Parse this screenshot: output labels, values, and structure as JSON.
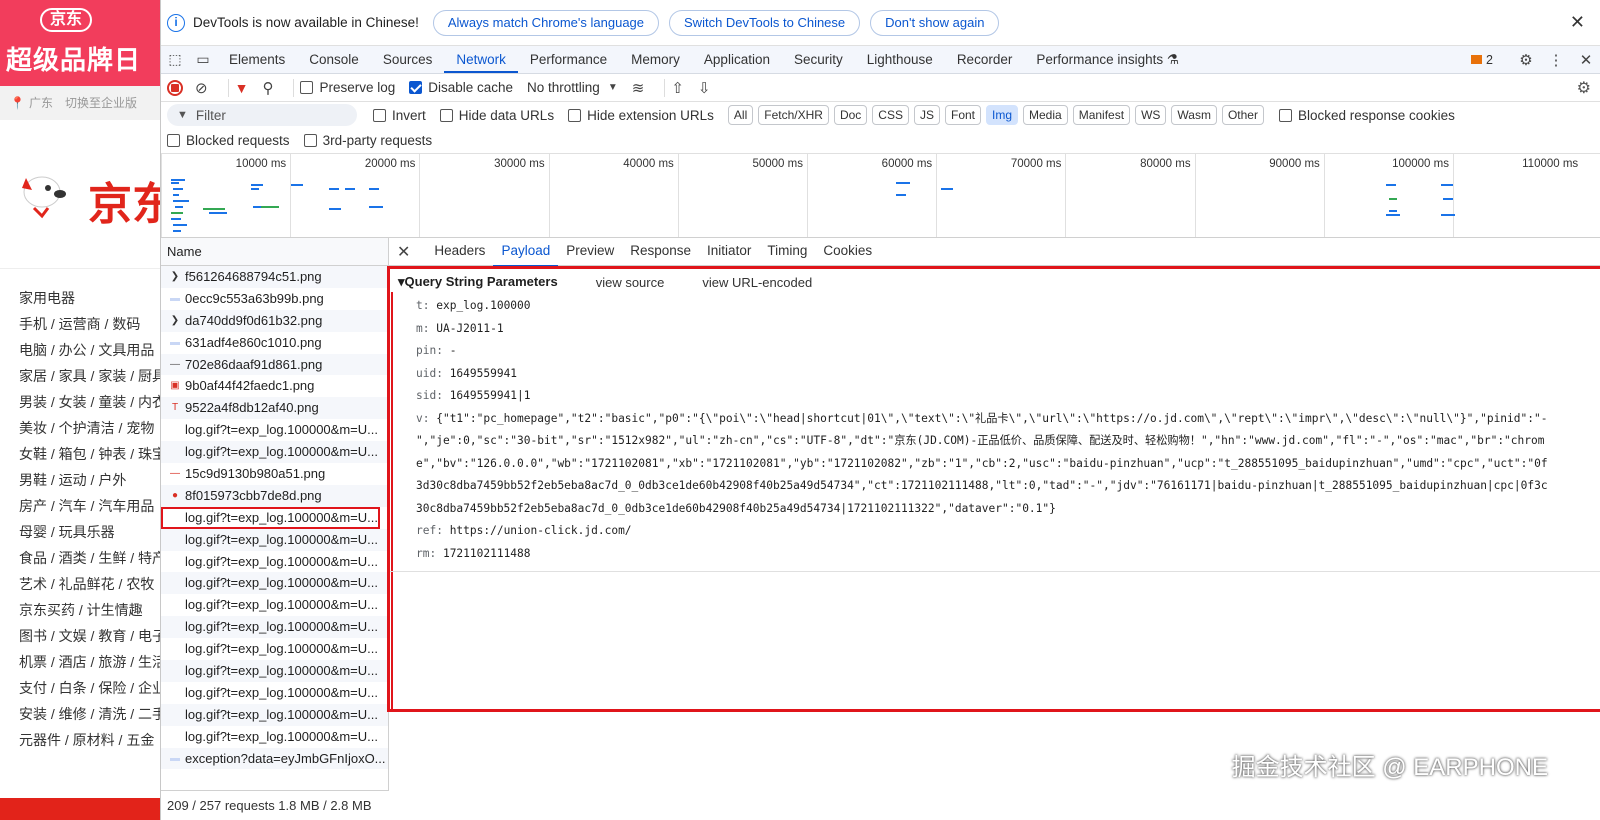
{
  "jd": {
    "banner_top": "京东",
    "banner_main": "超级品牌日",
    "location": "广东",
    "enterprise": "切换至企业版",
    "logo_text": "京东",
    "categories": [
      "家用电器",
      "手机 / 运营商 / 数码",
      "电脑 / 办公 / 文具用品",
      "家居 / 家具 / 家装 / 厨具",
      "男装 / 女装 / 童装 / 内衣",
      "美妆 / 个护清洁 / 宠物",
      "女鞋 / 箱包 / 钟表 / 珠宝",
      "男鞋 / 运动 / 户外",
      "房产 / 汽车 / 汽车用品",
      "母婴 / 玩具乐器",
      "食品 / 酒类 / 生鲜 / 特产",
      "艺术 / 礼品鲜花 / 农牧",
      "京东买药 / 计生情趣",
      "图书 / 文娱 / 教育 / 电子书",
      "机票 / 酒店 / 旅游 / 生活",
      "支付 / 白条 / 保险 / 企业",
      "安装 / 维修 / 清洗 / 二手",
      "元器件 / 原材料 / 五金"
    ]
  },
  "infobar": {
    "icon": "info-icon",
    "text": "DevTools is now available in Chinese!",
    "btn1": "Always match Chrome's language",
    "btn2": "Switch DevTools to Chinese",
    "btn3": "Don't show again",
    "close": "✕"
  },
  "tabs": [
    "Elements",
    "Console",
    "Sources",
    "Network",
    "Performance",
    "Memory",
    "Application",
    "Security",
    "Lighthouse",
    "Recorder",
    "Performance insights ⚗"
  ],
  "active_tab": "Network",
  "issues_count": "2",
  "toolbar": {
    "preserve_log": "Preserve log",
    "disable_cache": "Disable cache",
    "throttling": "No throttling"
  },
  "filter": {
    "placeholder": "Filter",
    "invert": "Invert",
    "hide_data": "Hide data URLs",
    "hide_ext": "Hide extension URLs",
    "chips": [
      "All",
      "Fetch/XHR",
      "Doc",
      "CSS",
      "JS",
      "Font",
      "Img",
      "Media",
      "Manifest",
      "WS",
      "Wasm",
      "Other"
    ],
    "active_chip": "Img",
    "blocked_cookies": "Blocked response cookies",
    "blocked_requests": "Blocked requests",
    "third_party": "3rd-party requests"
  },
  "overview_ticks": [
    "10000 ms",
    "20000 ms",
    "30000 ms",
    "40000 ms",
    "50000 ms",
    "60000 ms",
    "70000 ms",
    "80000 ms",
    "90000 ms",
    "100000 ms",
    "110000 ms"
  ],
  "requests": {
    "header": "Name",
    "rows": [
      {
        "icon": "chevron-right",
        "name": "f561264688794c51.png"
      },
      {
        "icon": "image",
        "name": "0ecc9c553a63b99b.png"
      },
      {
        "icon": "chevron-right",
        "name": "da740dd9f0d61b32.png"
      },
      {
        "icon": "image",
        "name": "631adf4e860c1010.png"
      },
      {
        "icon": "dash",
        "name": "702e86daaf91d861.png"
      },
      {
        "icon": "red-image",
        "name": "9b0af44f42faedc1.png"
      },
      {
        "icon": "red-t",
        "name": "9522a4f8db12af40.png"
      },
      {
        "icon": "none",
        "name": "log.gif?t=exp_log.100000&m=U..."
      },
      {
        "icon": "none",
        "name": "log.gif?t=exp_log.100000&m=U..."
      },
      {
        "icon": "red-dash",
        "name": "15c9d9130b980a51.png"
      },
      {
        "icon": "red-circle",
        "name": "8f015973cbb7de8d.png"
      },
      {
        "icon": "none",
        "name": "log.gif?t=exp_log.100000&m=U..."
      },
      {
        "icon": "none",
        "name": "log.gif?t=exp_log.100000&m=U..."
      },
      {
        "icon": "none",
        "name": "log.gif?t=exp_log.100000&m=U..."
      },
      {
        "icon": "none",
        "name": "log.gif?t=exp_log.100000&m=U..."
      },
      {
        "icon": "none",
        "name": "log.gif?t=exp_log.100000&m=U..."
      },
      {
        "icon": "none",
        "name": "log.gif?t=exp_log.100000&m=U..."
      },
      {
        "icon": "none",
        "name": "log.gif?t=exp_log.100000&m=U..."
      },
      {
        "icon": "none",
        "name": "log.gif?t=exp_log.100000&m=U..."
      },
      {
        "icon": "none",
        "name": "log.gif?t=exp_log.100000&m=U..."
      },
      {
        "icon": "none",
        "name": "log.gif?t=exp_log.100000&m=U..."
      },
      {
        "icon": "none",
        "name": "log.gif?t=exp_log.100000&m=U..."
      },
      {
        "icon": "image",
        "name": "exception?data=eyJmbGFnIjoxO..."
      }
    ],
    "selected_index": 11,
    "footer": "209 / 257 requests    1.8 MB / 2.8 MB"
  },
  "detail": {
    "tabs": [
      "Headers",
      "Payload",
      "Preview",
      "Response",
      "Initiator",
      "Timing",
      "Cookies"
    ],
    "active": "Payload",
    "section": "▾Query String Parameters",
    "view_source": "view source",
    "view_encoded": "view URL-encoded",
    "params": [
      {
        "k": "t:",
        "v": "exp_log.100000"
      },
      {
        "k": "m:",
        "v": "UA-J2011-1"
      },
      {
        "k": "pin:",
        "v": "-"
      },
      {
        "k": "uid:",
        "v": "1649559941"
      },
      {
        "k": "sid:",
        "v": "1649559941|1"
      },
      {
        "k": "v:",
        "v": "{\"t1\":\"pc_homepage\",\"t2\":\"basic\",\"p0\":\"{\\\"poi\\\":\\\"head|shortcut|01\\\",\\\"text\\\":\\\"礼品卡\\\",\\\"url\\\":\\\"https://o.jd.com\\\",\\\"rept\\\":\\\"impr\\\",\\\"desc\\\":\\\"null\\\"}\",\"pinid\":\"-"
      }
    ],
    "v_cont": [
      "\",\"je\":0,\"sc\":\"30-bit\",\"sr\":\"1512x982\",\"ul\":\"zh-cn\",\"cs\":\"UTF-8\",\"dt\":\"京东(JD.COM)-正品低价、品质保障、配送及时、轻松购物！\",\"hn\":\"www.jd.com\",\"fl\":\"-\",\"os\":\"mac\",\"br\":\"chrom",
      "e\",\"bv\":\"126.0.0.0\",\"wb\":\"1721102081\",\"xb\":\"1721102081\",\"yb\":\"1721102082\",\"zb\":\"1\",\"cb\":2,\"usc\":\"baidu-pinzhuan\",\"ucp\":\"t_288551095_baidupinzhuan\",\"umd\":\"cpc\",\"uct\":\"0f",
      "3d30c8dba7459bb52f2eb5eba8ac7d_0_0db3ce1de60b42908f40b25a49d54734\",\"ct\":1721102111488,\"lt\":0,\"tad\":\"-\",\"jdv\":\"76161171|baidu-pinzhuan|t_288551095_baidupinzhuan|cpc|0f3c",
      "30c8dba7459bb52f2eb5eba8ac7d_0_0db3ce1de60b42908f40b25a49d54734|1721102111322\",\"dataver\":\"0.1\"}"
    ],
    "params2": [
      {
        "k": "ref:",
        "v": "https://union-click.jd.com/"
      },
      {
        "k": "rm:",
        "v": "1721102111488"
      }
    ]
  },
  "watermark": "掘金技术社区 @ EARPHONE"
}
